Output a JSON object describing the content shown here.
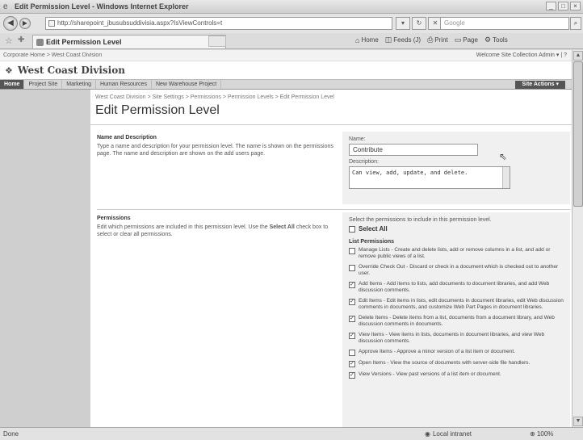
{
  "window": {
    "title": "Edit Permission Level - Windows Internet Explorer",
    "min": "_",
    "max": "□",
    "close": "×"
  },
  "address": {
    "url": "http://sharepoint_jbusubsuddivisia.aspx?IsViewControls=t",
    "search_placeholder": "Google"
  },
  "tab": {
    "label": "Edit Permission Level"
  },
  "commands": {
    "home": "Home",
    "feeds": "Feeds (J)",
    "print": "Print",
    "page": "Page",
    "tools": "Tools"
  },
  "sharepoint": {
    "top_links": "Corporate Home > West Coast Division",
    "welcome": "Welcome Site Collection Admin ▾ | ",
    "site_title": "West Coast Division",
    "nav": [
      "Home",
      "Project Site",
      "Marketing",
      "Human Resources",
      "New Warehouse Project"
    ],
    "site_actions": "Site Actions ▾"
  },
  "page": {
    "breadcrumb": "West Coast Division > Site Settings > Permissions > Permission Levels > Edit Permission Level",
    "title": "Edit Permission Level"
  },
  "name_section": {
    "heading": "Name and Description",
    "description": "Type a name and description for your permission level. The name is shown on the permissions page. The name and description are shown on the add users page.",
    "name_label": "Name:",
    "name_value": "Contribute",
    "desc_label": "Description:",
    "desc_value": "Can view, add, update, and delete."
  },
  "permissions_section": {
    "heading": "Permissions",
    "description_prefix": "Edit which permissions are included in this permission level. Use the ",
    "description_bold": "Select All",
    "description_suffix": " check box to select or clear all permissions.",
    "intro": "Select the permissions to include in this permission level.",
    "select_all": "Select All",
    "group_heading": "List Permissions",
    "items": [
      {
        "checked": false,
        "label": "Manage Lists - Create and delete lists, add or remove columns in a list, and add or remove public views of a list."
      },
      {
        "checked": false,
        "label": "Override Check Out - Discard or check in a document which is checked out to another user."
      },
      {
        "checked": true,
        "label": "Add Items - Add items to lists, add documents to document libraries, and add Web discussion comments."
      },
      {
        "checked": true,
        "label": "Edit Items - Edit items in lists, edit documents in document libraries, edit Web discussion comments in documents, and customize Web Part Pages in document libraries."
      },
      {
        "checked": true,
        "label": "Delete Items - Delete items from a list, documents from a document library, and Web discussion comments in documents."
      },
      {
        "checked": true,
        "label": "View Items - View items in lists, documents in document libraries, and view Web discussion comments."
      },
      {
        "checked": false,
        "label": "Approve Items - Approve a minor version of a list item or document."
      },
      {
        "checked": true,
        "label": "Open Items - View the source of documents with server-side file handlers."
      },
      {
        "checked": true,
        "label": "View Versions - View past versions of a list item or document."
      }
    ]
  },
  "status": {
    "left": "Done",
    "zone": "Local intranet",
    "zoom": "100%"
  }
}
